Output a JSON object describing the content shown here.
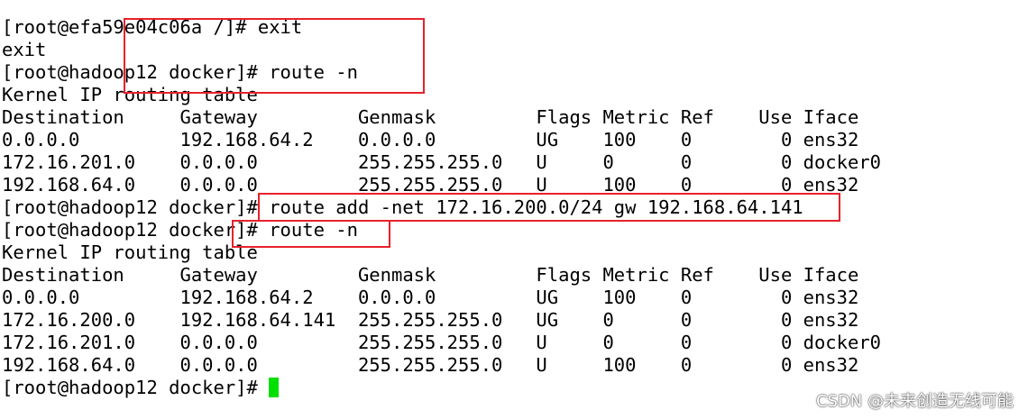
{
  "terminal": {
    "lines": [
      "[root@efa59e04c06a /]# exit",
      "exit",
      "[root@hadoop12 docker]# route -n",
      "Kernel IP routing table",
      "Destination     Gateway         Genmask         Flags Metric Ref    Use Iface",
      "0.0.0.0         192.168.64.2    0.0.0.0         UG    100    0        0 ens32",
      "172.16.201.0    0.0.0.0         255.255.255.0   U     0      0        0 docker0",
      "192.168.64.0    0.0.0.0         255.255.255.0   U     100    0        0 ens32",
      "[root@hadoop12 docker]# route add -net 172.16.200.0/24 gw 192.168.64.141",
      "[root@hadoop12 docker]# route -n",
      "Kernel IP routing table",
      "Destination     Gateway         Genmask         Flags Metric Ref    Use Iface",
      "0.0.0.0         192.168.64.2    0.0.0.0         UG    100    0        0 ens32",
      "172.16.200.0    192.168.64.141  255.255.255.0   UG    0      0        0 ens32",
      "172.16.201.0    0.0.0.0         255.255.255.0   U     0      0        0 docker0",
      "192.168.64.0    0.0.0.0         255.255.255.0   U     100    0        0 ens32",
      "[root@hadoop12 docker]# "
    ],
    "cursor_color": "#00e000"
  },
  "annotations": {
    "highlight_color": "#e8212b"
  },
  "watermark": {
    "text": "CSDN @未来创造无线可能"
  }
}
